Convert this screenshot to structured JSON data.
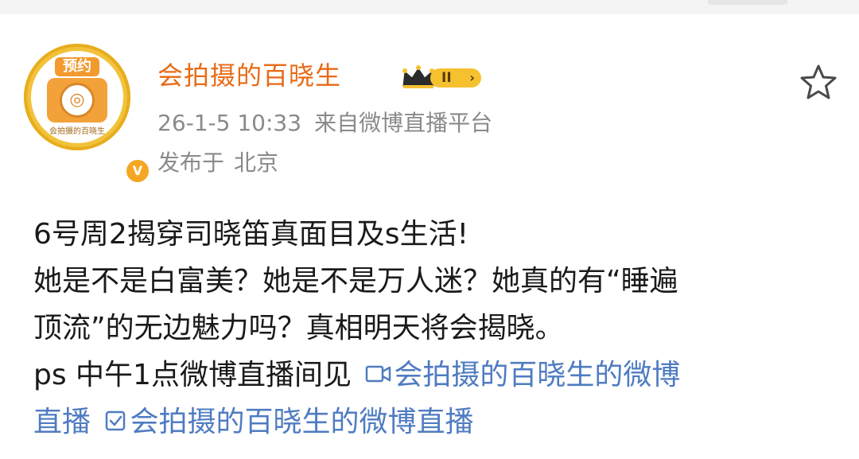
{
  "post": {
    "author": {
      "name": "会拍摄的百晓生",
      "avatar_badge": "预约",
      "avatar_caption": "会拍摄的百晓生",
      "verified_mark": "V",
      "level": "II"
    },
    "time": "26-1-5 10:33",
    "source": "来自微博直播平台",
    "location_prefix": "发布于",
    "location": "北京",
    "content": {
      "line1": "6号周2揭穿司晓笛真面目及s生活!",
      "line2": "她是不是白富美？她是不是万人迷？她真的有“睡遍",
      "line3": "顶流”的无边魅力吗？真相明天将会揭晓。",
      "line4_text": "ps 中午1点微博直播间见",
      "link1_part1": "会拍摄的百晓生的微博",
      "link1_part2": "直播",
      "link2": "会拍摄的百晓生的微博直播"
    }
  },
  "icons": {
    "favorite": "star-outline-icon",
    "crown": "crown-icon",
    "live_link": "live-camera-icon",
    "live_link_2": "checkbox-icon"
  },
  "colors": {
    "author_name": "#e86a16",
    "meta": "#8a8a8a",
    "link": "#4f7cc1",
    "avatar_ring": "#f2c23a"
  }
}
